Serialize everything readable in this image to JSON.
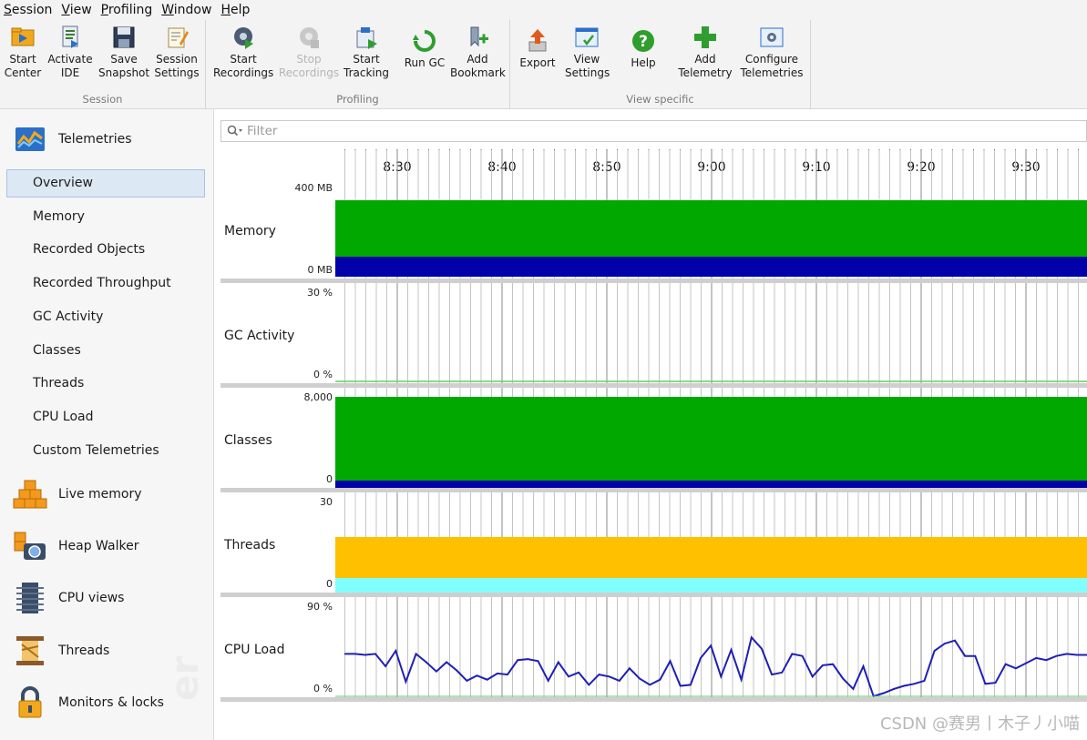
{
  "menu": [
    {
      "label": "Session",
      "ul": "S",
      "rest": "ession"
    },
    {
      "label": "View",
      "ul": "V",
      "rest": "iew"
    },
    {
      "label": "Profiling",
      "ul": "P",
      "rest": "rofiling"
    },
    {
      "label": "Window",
      "ul": "W",
      "rest": "indow"
    },
    {
      "label": "Help",
      "ul": "H",
      "rest": "elp"
    }
  ],
  "toolbar": {
    "session": {
      "group_label": "Session",
      "start_center": "Start\nCenter",
      "activate_ide": "Activate\nIDE",
      "save_snapshot": "Save\nSnapshot",
      "session_settings": "Session\nSettings"
    },
    "profiling": {
      "group_label": "Profiling",
      "start_recordings": "Start\nRecordings",
      "stop_recordings": "Stop\nRecordings",
      "start_tracking": "Start\nTracking",
      "run_gc": "Run GC",
      "add_bookmark": "Add\nBookmark"
    },
    "view_specific": {
      "group_label": "View specific",
      "export": "Export",
      "view_settings": "View\nSettings",
      "help": "Help",
      "add_telemetry": "Add\nTelemetry",
      "configure_telemetries": "Configure\nTelemetries"
    }
  },
  "sidebar": {
    "telemetries_label": "Telemetries",
    "items": [
      "Overview",
      "Memory",
      "Recorded Objects",
      "Recorded Throughput",
      "GC Activity",
      "Classes",
      "Threads",
      "CPU Load",
      "Custom Telemetries"
    ],
    "selected_index": 0,
    "sections": [
      "Live memory",
      "Heap Walker",
      "CPU views",
      "Threads",
      "Monitors & locks"
    ],
    "watermark": "er"
  },
  "filter": {
    "placeholder": "Filter",
    "icon": "search-icon"
  },
  "time_axis": {
    "labels": [
      "8:30",
      "8:40",
      "8:50",
      "9:00",
      "9:10",
      "9:20",
      "9:30"
    ]
  },
  "colors": {
    "green": "#00a800",
    "navy": "#0000aa",
    "orange": "#ffc000",
    "cyan": "#80ffff",
    "cpu_line": "#1f1fb4"
  },
  "charts": {
    "memory": {
      "label": "Memory",
      "max": "400 MB",
      "min": "0 MB"
    },
    "gc": {
      "label": "GC Activity",
      "max": "30 %",
      "min": "0 %"
    },
    "classes": {
      "label": "Classes",
      "max": "8,000",
      "min": "0"
    },
    "threads": {
      "label": "Threads",
      "max": "30",
      "min": "0"
    },
    "cpu": {
      "label": "CPU Load",
      "max": "90 %",
      "min": "0 %"
    }
  },
  "chart_data": {
    "type": "line",
    "title": "CPU Load",
    "ylim": [
      0,
      90
    ],
    "x": [
      "8:25",
      "8:26",
      "8:27",
      "8:28",
      "8:29",
      "8:30",
      "8:31",
      "8:32",
      "8:33",
      "8:34",
      "8:35",
      "8:36",
      "8:37",
      "8:38",
      "8:39",
      "8:40",
      "8:41",
      "8:42",
      "8:43",
      "8:44",
      "8:45",
      "8:46",
      "8:47",
      "8:48",
      "8:49",
      "8:50",
      "8:51",
      "8:52",
      "8:53",
      "8:54",
      "8:55",
      "8:56",
      "8:57",
      "8:58",
      "8:59",
      "9:00",
      "9:01",
      "9:02",
      "9:03",
      "9:04",
      "9:05",
      "9:06",
      "9:07",
      "9:08",
      "9:09",
      "9:10",
      "9:11",
      "9:12",
      "9:13",
      "9:14",
      "9:15",
      "9:16",
      "9:17",
      "9:18",
      "9:19",
      "9:20",
      "9:21",
      "9:22",
      "9:23",
      "9:24",
      "9:25",
      "9:26",
      "9:27",
      "9:28",
      "9:29",
      "9:30",
      "9:31",
      "9:32",
      "9:33",
      "9:34",
      "9:35",
      "9:36"
    ],
    "series": [
      {
        "values": [
          42,
          42,
          41,
          42,
          30,
          45,
          15,
          42,
          34,
          25,
          34,
          26,
          16,
          21,
          17,
          23,
          22,
          36,
          37,
          35,
          16,
          34,
          20,
          24,
          12,
          22,
          20,
          16,
          28,
          18,
          12,
          17,
          35,
          11,
          12,
          38,
          50,
          20,
          46,
          17,
          58,
          47,
          22,
          24,
          42,
          40,
          20,
          31,
          32,
          18,
          8,
          30,
          1,
          4,
          8,
          11,
          13,
          16,
          45,
          52,
          55,
          40,
          40,
          13,
          14,
          32,
          28,
          33,
          38,
          36,
          40,
          42,
          41,
          41
        ]
      }
    ]
  }
}
